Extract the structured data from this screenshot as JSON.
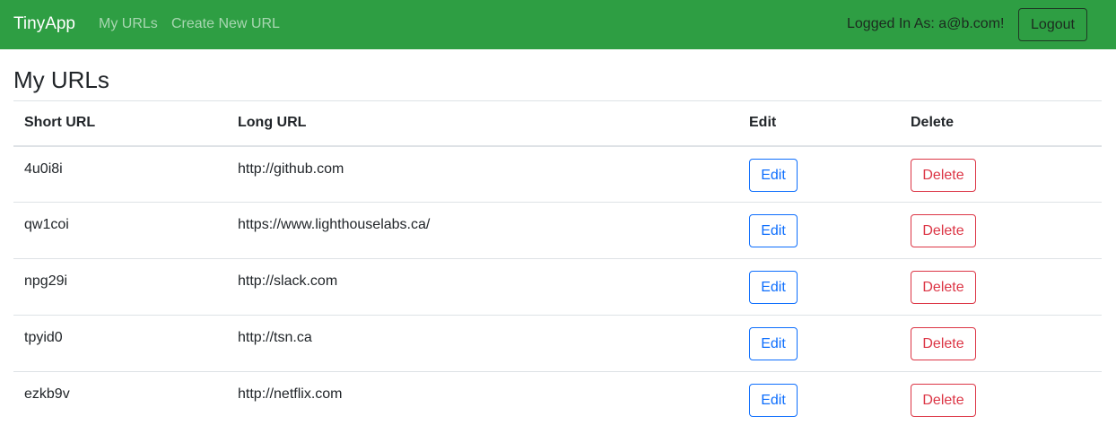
{
  "navbar": {
    "brand": "TinyApp",
    "links": {
      "my_urls": "My URLs",
      "create_new_url": "Create New URL"
    },
    "logged_in_text": "Logged In As: a@b.com!",
    "logout_label": "Logout",
    "background_color": "#2e9e43"
  },
  "main": {
    "title": "My URLs",
    "table": {
      "headers": {
        "short_url": "Short URL",
        "long_url": "Long URL",
        "edit": "Edit",
        "delete": "Delete"
      },
      "rows": [
        {
          "short_url": "4u0i8i",
          "long_url": "http://github.com",
          "edit_label": "Edit",
          "delete_label": "Delete"
        },
        {
          "short_url": "qw1coi",
          "long_url": "https://www.lighthouselabs.ca/",
          "edit_label": "Edit",
          "delete_label": "Delete"
        },
        {
          "short_url": "npg29i",
          "long_url": "http://slack.com",
          "edit_label": "Edit",
          "delete_label": "Delete"
        },
        {
          "short_url": "tpyid0",
          "long_url": "http://tsn.ca",
          "edit_label": "Edit",
          "delete_label": "Delete"
        },
        {
          "short_url": "ezkb9v",
          "long_url": "http://netflix.com",
          "edit_label": "Edit",
          "delete_label": "Delete"
        }
      ]
    },
    "colors": {
      "edit_accent": "#0d6efd",
      "delete_accent": "#dc3545"
    }
  }
}
